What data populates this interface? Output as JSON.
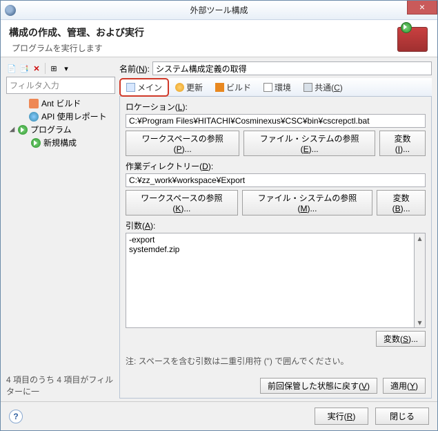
{
  "title": "外部ツール構成",
  "header": {
    "title": "構成の作成、管理、および実行",
    "sub": "プログラムを実行します"
  },
  "filter_placeholder": "フィルタ入力",
  "tree": {
    "ant": "Ant ビルド",
    "api": "API 使用レポート",
    "prog": "プログラム",
    "new": "新規構成"
  },
  "left_footer": "4 項目のうち 4 項目がフィルターに一",
  "name_label_pre": "名前(",
  "name_label_u": "N",
  "name_label_post": "):",
  "name_value": "システム構成定義の取得",
  "tabs": {
    "main": "メイン",
    "refresh": "更新",
    "build": "ビルド",
    "env": "環境",
    "common_pre": "共通(",
    "common_u": "C",
    "common_post": ")"
  },
  "loc": {
    "label_pre": "ロケーション(",
    "label_u": "L",
    "label_post": "):",
    "value": "C:¥Program Files¥HITACHI¥Cosminexus¥CSC¥bin¥cscrepctl.bat",
    "ws_pre": "ワークスペースの参照(",
    "ws_u": "P",
    "ws_post": ")...",
    "fs_pre": "ファイル・システムの参照(",
    "fs_u": "E",
    "fs_post": ")...",
    "var_pre": "変数(",
    "var_u": "I",
    "var_post": ")..."
  },
  "wd": {
    "label_pre": "作業ディレクトリー(",
    "label_u": "D",
    "label_post": "):",
    "value": "C:¥zz_work¥workspace¥Export",
    "ws_pre": "ワークスペースの参照(",
    "ws_u": "K",
    "ws_post": ")...",
    "fs_pre": "ファイル・システムの参照(",
    "fs_u": "M",
    "fs_post": ")...",
    "var_pre": "変数(",
    "var_u": "B",
    "var_post": ")..."
  },
  "args": {
    "label_pre": "引数(",
    "label_u": "A",
    "label_post": "):",
    "value": "-export\nsystemdef.zip",
    "var_pre": "変数(",
    "var_u": "S",
    "var_post": ")..."
  },
  "note": "注: スペースを含む引数は二重引用符 (\") で囲んでください。",
  "revert_pre": "前回保管した状態に戻す(",
  "revert_u": "V",
  "revert_post": ")",
  "apply_pre": "適用(",
  "apply_u": "Y",
  "apply_post": ")",
  "run_pre": "実行(",
  "run_u": "R",
  "run_post": ")",
  "close": "閉じる"
}
